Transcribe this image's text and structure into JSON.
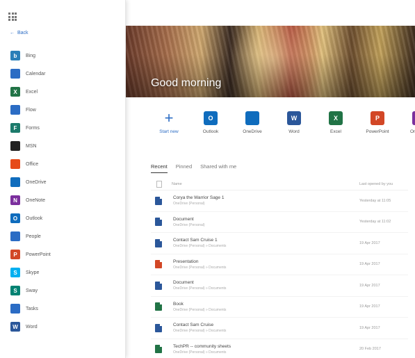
{
  "launcher": {
    "back_label": "Back",
    "apps": [
      {
        "label": "Bing",
        "icon": "bing-icon",
        "color": "#2a7fb8",
        "glyph": "b"
      },
      {
        "label": "Calendar",
        "icon": "calendar-icon",
        "color": "#2b6cc4",
        "glyph": ""
      },
      {
        "label": "Excel",
        "icon": "excel-icon",
        "color": "#217346",
        "glyph": "X"
      },
      {
        "label": "Flow",
        "icon": "flow-icon",
        "color": "#2b6cc4",
        "glyph": ""
      },
      {
        "label": "Forms",
        "icon": "forms-icon",
        "color": "#1c7a6b",
        "glyph": "F"
      },
      {
        "label": "MSN",
        "icon": "msn-icon",
        "color": "#222222",
        "glyph": ""
      },
      {
        "label": "Office",
        "icon": "office-icon",
        "color": "#e64a19",
        "glyph": ""
      },
      {
        "label": "OneDrive",
        "icon": "onedrive-icon",
        "color": "#0f6cbd",
        "glyph": ""
      },
      {
        "label": "OneNote",
        "icon": "onenote-icon",
        "color": "#7b2f9d",
        "glyph": "N"
      },
      {
        "label": "Outlook",
        "icon": "outlook-icon",
        "color": "#0f6cbd",
        "glyph": "O"
      },
      {
        "label": "People",
        "icon": "people-icon",
        "color": "#2b6cc4",
        "glyph": ""
      },
      {
        "label": "PowerPoint",
        "icon": "powerpoint-icon",
        "color": "#d24726",
        "glyph": "P"
      },
      {
        "label": "Skype",
        "icon": "skype-icon",
        "color": "#00aff0",
        "glyph": "S"
      },
      {
        "label": "Sway",
        "icon": "sway-icon",
        "color": "#008272",
        "glyph": "S"
      },
      {
        "label": "Tasks",
        "icon": "tasks-icon",
        "color": "#2b6cc4",
        "glyph": ""
      },
      {
        "label": "Word",
        "icon": "word-icon",
        "color": "#2b579a",
        "glyph": "W"
      }
    ]
  },
  "hero": {
    "greeting": "Good morning"
  },
  "quick_apps": [
    {
      "label": "Start new",
      "icon": "plus-icon",
      "color": "#2b6cc4",
      "glyph": "+"
    },
    {
      "label": "Outlook",
      "icon": "outlook-icon",
      "color": "#0f6cbd",
      "glyph": "O"
    },
    {
      "label": "OneDrive",
      "icon": "onedrive-icon",
      "color": "#0f6cbd",
      "glyph": ""
    },
    {
      "label": "Word",
      "icon": "word-icon",
      "color": "#2b579a",
      "glyph": "W"
    },
    {
      "label": "Excel",
      "icon": "excel-icon",
      "color": "#217346",
      "glyph": "X"
    },
    {
      "label": "PowerPoint",
      "icon": "powerpoint-icon",
      "color": "#d24726",
      "glyph": "P"
    },
    {
      "label": "OneNote",
      "icon": "onenote-icon",
      "color": "#7b2f9d",
      "glyph": "N"
    }
  ],
  "tabs": [
    "Recent",
    "Pinned",
    "Shared with me"
  ],
  "list": {
    "col_name": "Name",
    "col_date": "Last opened by you",
    "rows": [
      {
        "name": "Corya the Warrior Sage 1",
        "location": "OneDrive (Personal)",
        "date": "Yesterday at 11:05",
        "type": "word",
        "color": "#2b579a"
      },
      {
        "name": "Document",
        "location": "OneDrive (Personal)",
        "date": "Yesterday at 11:02",
        "type": "word",
        "color": "#2b579a"
      },
      {
        "name": "Contact Sam Cruise 1",
        "location": "OneDrive (Personal) » Documents",
        "date": "19 Apr 2017",
        "type": "word",
        "color": "#2b579a"
      },
      {
        "name": "Presentation",
        "location": "OneDrive (Personal) » Documents",
        "date": "19 Apr 2017",
        "type": "powerpoint",
        "color": "#d24726"
      },
      {
        "name": "Document",
        "location": "OneDrive (Personal) » Documents",
        "date": "19 Apr 2017",
        "type": "word",
        "color": "#2b579a"
      },
      {
        "name": "Book",
        "location": "OneDrive (Personal) » Documents",
        "date": "19 Apr 2017",
        "type": "excel",
        "color": "#217346"
      },
      {
        "name": "Contact Sam Cruise",
        "location": "OneDrive (Personal) » Documents",
        "date": "19 Apr 2017",
        "type": "word",
        "color": "#2b579a"
      },
      {
        "name": "TechPR -- community sheets",
        "location": "OneDrive (Personal) » Documents",
        "date": "20 Feb 2017",
        "type": "excel",
        "color": "#217346"
      }
    ]
  }
}
